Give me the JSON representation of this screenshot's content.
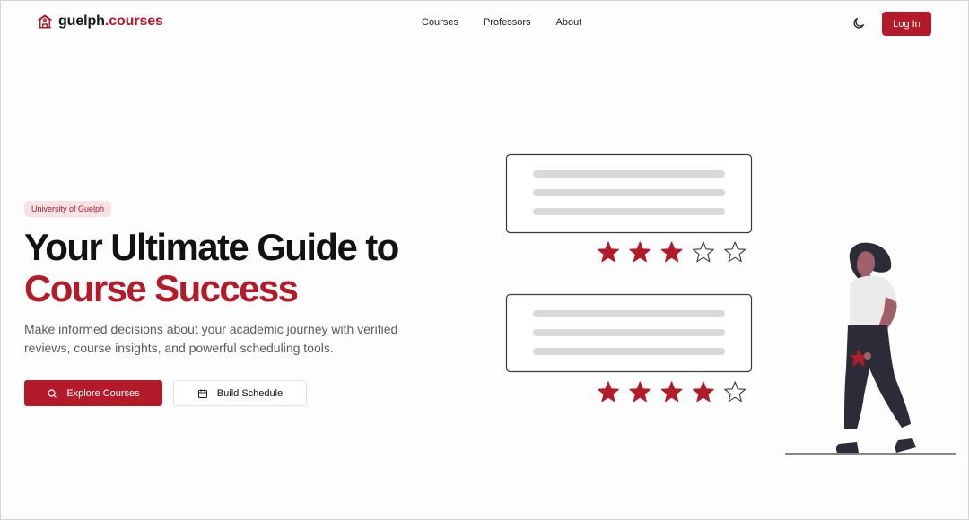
{
  "brand": {
    "name_part1": "guelph",
    "name_part2": ".courses",
    "icon": "university-building-icon",
    "accent_color": "#b31b2b"
  },
  "nav": {
    "links": [
      {
        "label": "Courses"
      },
      {
        "label": "Professors"
      },
      {
        "label": "About"
      }
    ],
    "theme_icon": "moon-icon",
    "login_label": "Log In"
  },
  "hero": {
    "badge": "University of Guelph",
    "headline_line1": "Your Ultimate Guide to",
    "headline_line2": "Course Success",
    "subtitle": "Make informed decisions about your academic journey with verified reviews, course insights, and powerful scheduling tools.",
    "primary_button": {
      "label": "Explore Courses",
      "icon": "search-icon"
    },
    "secondary_button": {
      "label": "Build Schedule",
      "icon": "calendar-icon"
    }
  },
  "illustration": {
    "reviews": [
      {
        "rating": 3,
        "max": 5
      },
      {
        "rating": 4,
        "max": 5
      }
    ],
    "star_color": "#b31b2b"
  }
}
